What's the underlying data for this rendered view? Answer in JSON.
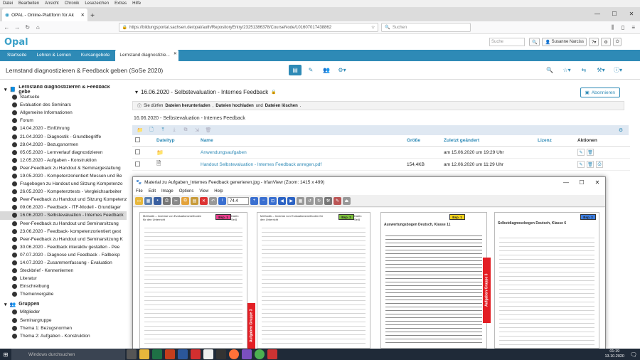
{
  "browser": {
    "menu": [
      "Datei",
      "Bearbeiten",
      "Ansicht",
      "Chronik",
      "Lesezeichen",
      "Extras",
      "Hilfe"
    ],
    "tab_title": "OPAL - Online-Plattform für Ak",
    "url": "https://bildungsportal.sachsen.de/opal/auth/RepositoryEntry/23251386378/CourseNode/101607017438862",
    "search_placeholder": "Suchen"
  },
  "opal": {
    "logo": "Opal",
    "search_placeholder": "Suche",
    "user": "Susanne Narciss",
    "tabs": [
      "Startseite",
      "Lehren & Lernen",
      "Kursangebote",
      "Lernstand diagnostizie..."
    ],
    "course_title": "Lernstand diagnostizieren & Feedback geben (SoSe 2020)"
  },
  "sidebar": {
    "title": "Lernstand diagnostizieren & Feedback gebe",
    "items": [
      "Startseite",
      "Evaluation des Seminars",
      "Allgemeine Informationen",
      "Forum",
      "14.04.2020 - Einführung",
      "21.04.2020 - Diagnostik - Grundbegriffe",
      "28.04.2020 - Bezugsnormen",
      "05.05.2020 - Lernverlauf diagnostizieren",
      "12.05.2020 - Aufgaben - Konstruktion",
      "Peer-Feedback zu Handout & Seminargestaltung",
      "19.05.2020 - Kompetenzorientiert Messen und Be",
      "Fragebogen zu Handout und Sitzung Kompetenzo",
      "26.05.2020 - Kompetenztests - Vergleichsarbeiter",
      "Peer-Feedback zu Handout und Sitzung Kompetenz",
      "09.06.2020 - Feedback - ITF-Modell - Grundlager",
      "16.06.2020 - Selbstevaluation - Internes Feedback",
      "Peer-Feedback zu Handout und Seminarsitzung",
      "23.06.2020 - Feedback- kompetenzorientiert gest",
      "Peer-Feedback zu Handout und Seminarsitzung K",
      "30.06.2020 - Feedback interaktiv gestalten - Pee",
      "07.07.2020 - Diagnose und Feedback - Fallbeisp",
      "14.07.2020 - Zusammenfassung - Evaluation",
      "Steckbrief - Kennenlernen",
      "Literatur",
      "Einschreibung",
      "Themenvergabe"
    ],
    "groups_title": "Gruppen",
    "groups": [
      "Mitglieder",
      "Seminargruppe",
      "Thema 1: Bezugsnormen",
      "Thema 2: Aufgaben - Konstruktion"
    ]
  },
  "main": {
    "section_title": "16.06.2020 - Selbstevaluation - Internes Feedback",
    "subscribe": "Abonnieren",
    "info_prefix": "Sie dürfen",
    "info_b1": "Dateien herunterladen",
    "info_b2": "Dateien hochladen",
    "info_and": "und",
    "info_b3": "Dateien löschen",
    "folder_name": "16.06.2020 - Selbstevaluation - Internes Feedback",
    "headers": [
      "Dateityp",
      "Name",
      "Größe",
      "Zuletzt geändert",
      "Lizenz",
      "Aktionen"
    ],
    "rows": [
      {
        "name": "Anwendungsaufgaben",
        "size": "",
        "date": "am 15.06.2020 um 19:29 Uhr"
      },
      {
        "name": "Handout Selbstevaluation - Internes Feedback anregen.pdf",
        "size": "154,4KB",
        "date": "am 12.06.2020 um 11:29 Uhr"
      }
    ]
  },
  "irfan": {
    "title": "Material zu Aufgaben_Internes Feedback generieren.jpg - IrfanView (Zoom: 1415 x 499)",
    "menu": [
      "File",
      "Edit",
      "Image",
      "Options",
      "View",
      "Help"
    ],
    "zoom": "74.4",
    "pages": [
      {
        "header": "Methodik – Inventar von Evaluationsmethoden für den Unterricht",
        "badge": "Bsp. 1",
        "badge_color": "#e83e8c",
        "name": "Katrin Seiß"
      },
      {
        "header": "Methodik – Inventar von Evaluationsmethoden für den Unterricht",
        "badge": "Bsp. 2",
        "badge_color": "#7bbf3a",
        "name": "Katrin Seiß"
      },
      {
        "header": "Auswertungsbogen Deutsch, Klasse 11",
        "badge": "Bsp. 1",
        "badge_color": "#f2d21b",
        "name": ""
      },
      {
        "header": "Selbstdiagnosebogen Deutsch, Klasse 6",
        "badge": "Bsp. 2",
        "badge_color": "#3b7de0",
        "name": ""
      }
    ],
    "group_label": "Aufgaben Gruppe 3"
  },
  "taskbar": {
    "search": "Windows durchsuchen",
    "time": "01:19",
    "date": "13.10.2020"
  }
}
